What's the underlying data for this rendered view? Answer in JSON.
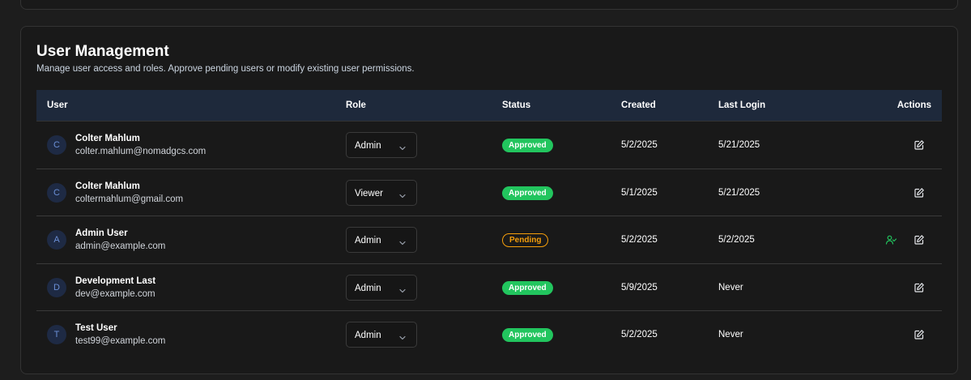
{
  "header": {
    "title": "User Management",
    "subtitle": "Manage user access and roles. Approve pending users or modify existing user permissions."
  },
  "table": {
    "columns": {
      "user": "User",
      "role": "Role",
      "status": "Status",
      "created": "Created",
      "last_login": "Last Login",
      "actions": "Actions"
    },
    "rows": [
      {
        "initial": "C",
        "name": "Colter Mahlum",
        "email": "colter.mahlum@nomadgcs.com",
        "role": "Admin",
        "status": "Approved",
        "created": "5/2/2025",
        "last_login": "5/21/2025"
      },
      {
        "initial": "C",
        "name": "Colter Mahlum",
        "email": "coltermahlum@gmail.com",
        "role": "Viewer",
        "status": "Approved",
        "created": "5/1/2025",
        "last_login": "5/21/2025"
      },
      {
        "initial": "A",
        "name": "Admin User",
        "email": "admin@example.com",
        "role": "Admin",
        "status": "Pending",
        "created": "5/2/2025",
        "last_login": "5/2/2025"
      },
      {
        "initial": "D",
        "name": "Development Last",
        "email": "dev@example.com",
        "role": "Admin",
        "status": "Approved",
        "created": "5/9/2025",
        "last_login": "Never"
      },
      {
        "initial": "T",
        "name": "Test User",
        "email": "test99@example.com",
        "role": "Admin",
        "status": "Approved",
        "created": "5/2/2025",
        "last_login": "Never"
      }
    ]
  },
  "colors": {
    "approved": "#22c55e",
    "pending": "#f59e0b",
    "header_bg": "#1e293b",
    "approve_icon": "#22c55e"
  },
  "icons": {
    "edit": "edit-icon",
    "approve": "user-check-icon",
    "dropdown": "chevron-down-icon"
  }
}
